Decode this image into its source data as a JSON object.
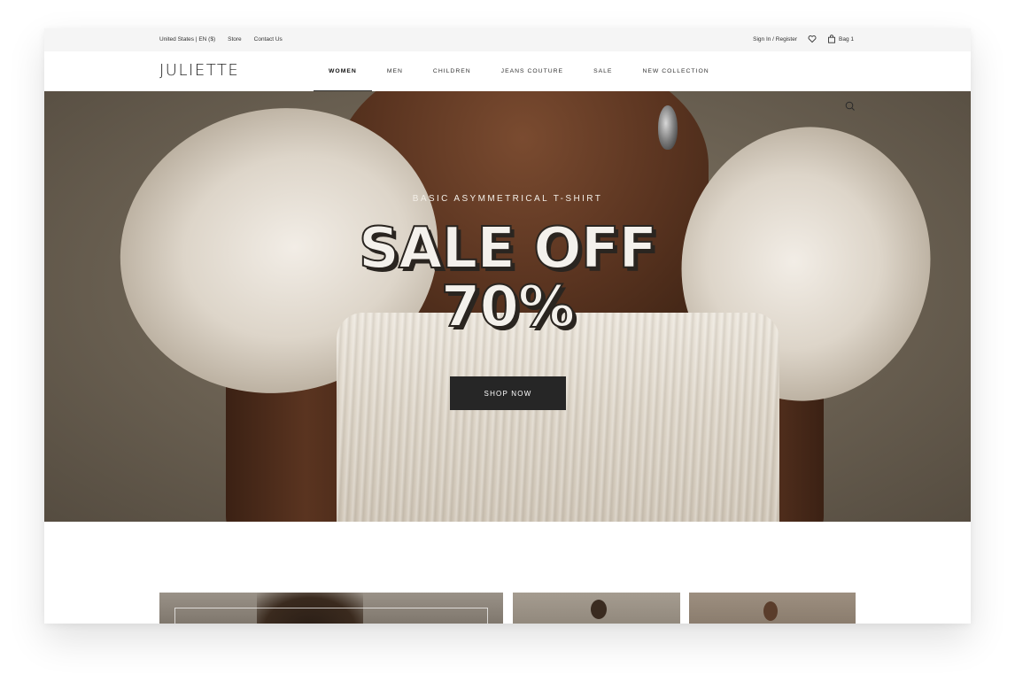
{
  "topbar": {
    "region": "United States | EN ($)",
    "store": "Store",
    "contact": "Contact Us",
    "signin": "Sign In / Register",
    "bag": "Bag 1"
  },
  "brand": {
    "logo": "JULIETTE"
  },
  "menu": [
    {
      "label": "WOMEN",
      "active": true
    },
    {
      "label": "MEN"
    },
    {
      "label": "CHILDREN"
    },
    {
      "label": "JEANS COUTURE"
    },
    {
      "label": "SALE"
    },
    {
      "label": "NEW COLLECTION"
    }
  ],
  "hero": {
    "subtitle": "BASIC ASYMMETRICAL T-SHIRT",
    "headline_line1": "SALE OFF",
    "headline_line2": "70%",
    "cta": "SHOP NOW"
  },
  "icons": {
    "search": "search-icon",
    "wishlist": "heart-icon",
    "bag": "shopping-bag-icon"
  }
}
